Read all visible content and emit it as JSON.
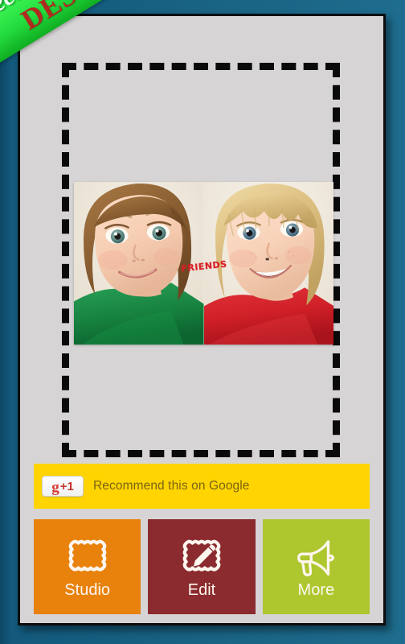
{
  "app": {
    "background_color": "#175a7c",
    "card_color": "#d6d4d5"
  },
  "promo_ribbon": {
    "line1": "Special version of",
    "line2": "DESIGNS",
    "ribbon_color": "#23da3d",
    "line1_color": "#ffffff",
    "line2_color": "#b02a20"
  },
  "collage": {
    "caption": "FRIENDS",
    "caption_color": "#d81f26",
    "selection_border_color": "#0a0a0a",
    "photos": [
      {
        "alt": "Child in green shirt smiling",
        "shirt_color": "#1e8c4a"
      },
      {
        "alt": "Child in red shirt smiling",
        "shirt_color": "#d3212b"
      }
    ]
  },
  "google_plusone": {
    "badge_g": "g",
    "badge_count": "+1",
    "label": "Recommend this on Google",
    "bar_color": "#ffd400",
    "label_color": "#7a6413"
  },
  "actions": [
    {
      "id": "studio",
      "label": "Studio",
      "color": "#e8820c",
      "icon": "picture-frame-icon"
    },
    {
      "id": "edit",
      "label": "Edit",
      "color": "#8b2b2f",
      "icon": "frame-pencil-icon"
    },
    {
      "id": "more",
      "label": "More",
      "color": "#aec72e",
      "icon": "megaphone-icon"
    }
  ]
}
